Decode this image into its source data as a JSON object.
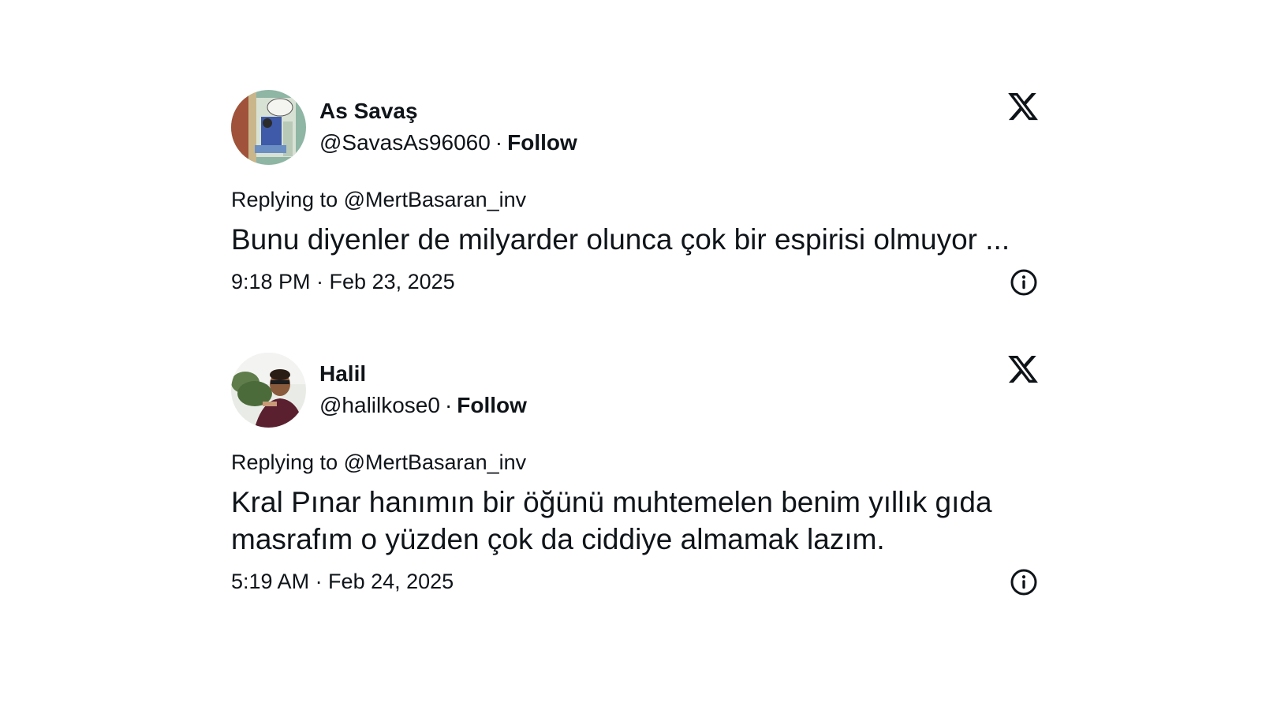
{
  "tweets": [
    {
      "display_name": "As Savaş",
      "handle": "@SavasAs96060",
      "separator": "·",
      "follow_label": "Follow",
      "replying_prefix": "Replying to",
      "replying_to": "@MertBasaran_inv",
      "text": "Bunu diyenler de milyarder olunca çok bir espirisi olmuyor ...",
      "timestamp": "9:18 PM · Feb 23, 2025",
      "avatar_icon": "comic-avatar",
      "platform_icon": "x-logo-icon",
      "info_icon": "info-icon"
    },
    {
      "display_name": "Halil",
      "handle": "@halilkose0",
      "separator": "·",
      "follow_label": "Follow",
      "replying_prefix": "Replying to",
      "replying_to": "@MertBasaran_inv",
      "text": "Kral Pınar hanımın bir öğünü muhtemelen benim yıllık gıda masrafım o yüzden çok da ciddiye almamak lazım.",
      "timestamp": "5:19 AM · Feb 24, 2025",
      "avatar_icon": "photo-avatar",
      "platform_icon": "x-logo-icon",
      "info_icon": "info-icon"
    }
  ],
  "colors": {
    "text": "#0f1419",
    "background": "#ffffff"
  }
}
